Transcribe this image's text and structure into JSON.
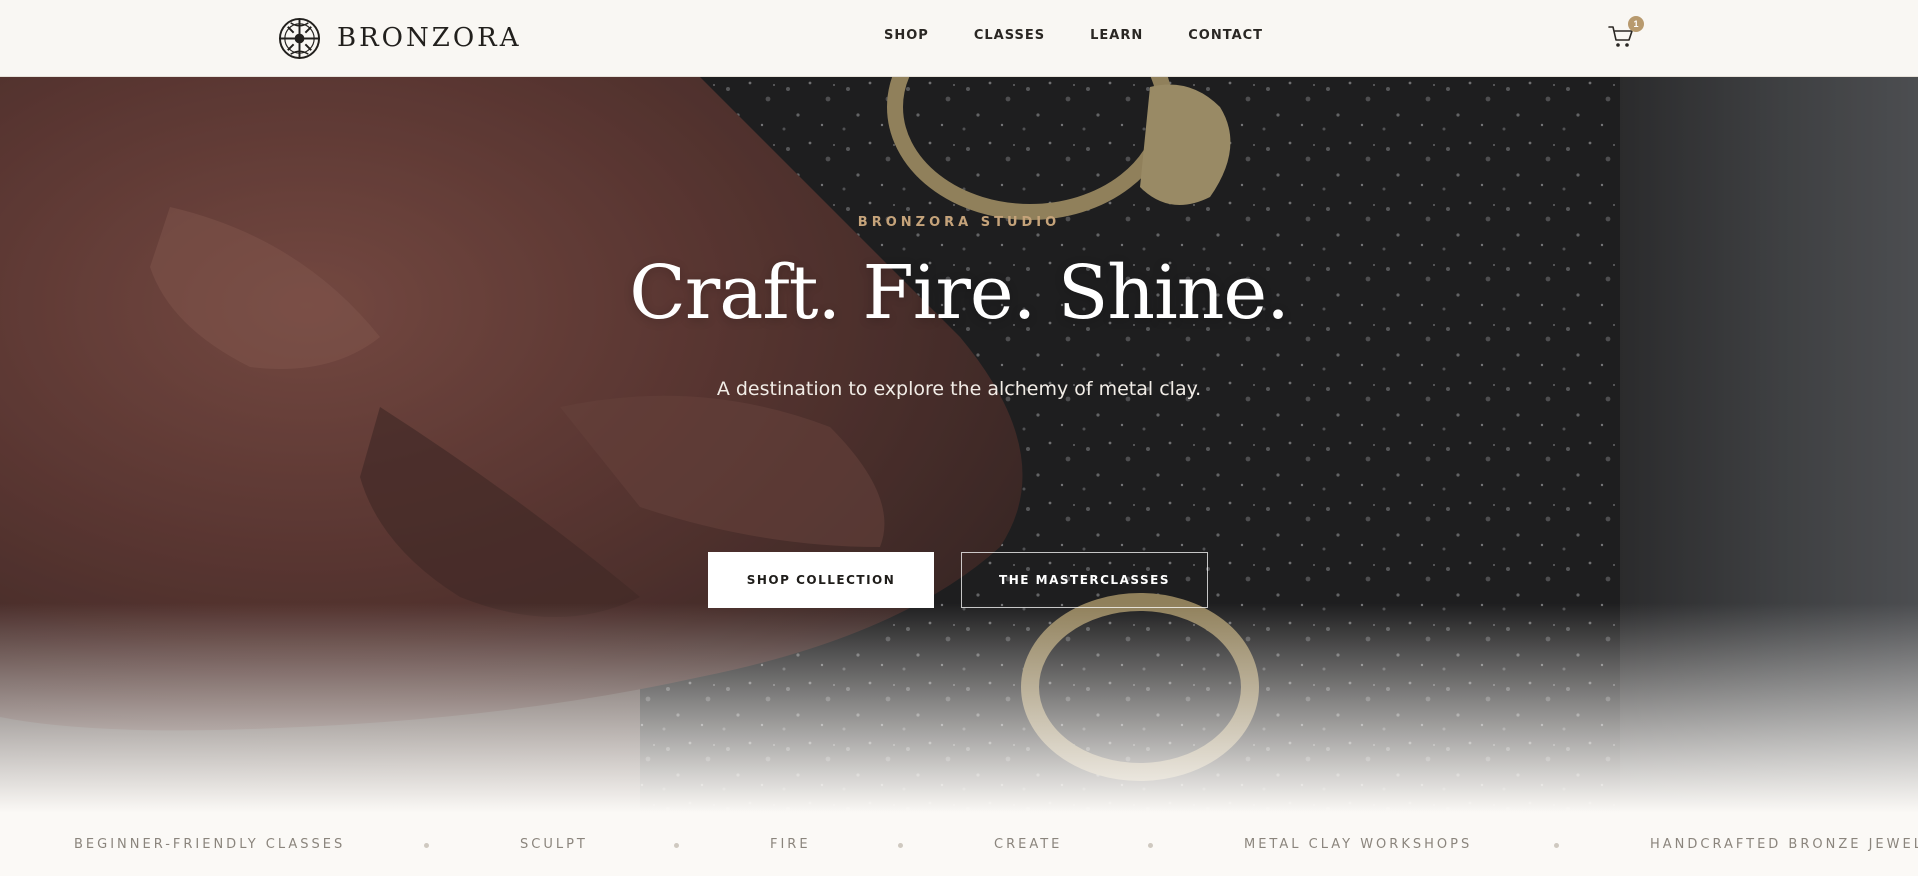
{
  "header": {
    "brand_name": "BRONZORA",
    "nav": [
      "SHOP",
      "CLASSES",
      "LEARN",
      "CONTACT"
    ],
    "cart_count": "1"
  },
  "hero": {
    "eyebrow": "BRONZORA STUDIO",
    "headline": "Craft. Fire. Shine.",
    "subhead": "A destination to explore the alchemy of metal clay.",
    "primary_cta": "SHOP COLLECTION",
    "secondary_cta": "THE MASTERCLASSES"
  },
  "marquee": {
    "items": [
      "BEGINNER-FRIENDLY CLASSES",
      "SCULPT",
      "FIRE",
      "CREATE",
      "METAL CLAY WORKSHOPS",
      "HANDCRAFTED BRONZE JEWELRY"
    ]
  },
  "colors": {
    "accent": "#c5a37a",
    "badge": "#b89a6e",
    "header_bg": "#f9f7f3",
    "text_dark": "#22201d"
  },
  "icons": {
    "logo": "bronzora-emblem-icon",
    "cart": "shopping-cart-icon"
  }
}
